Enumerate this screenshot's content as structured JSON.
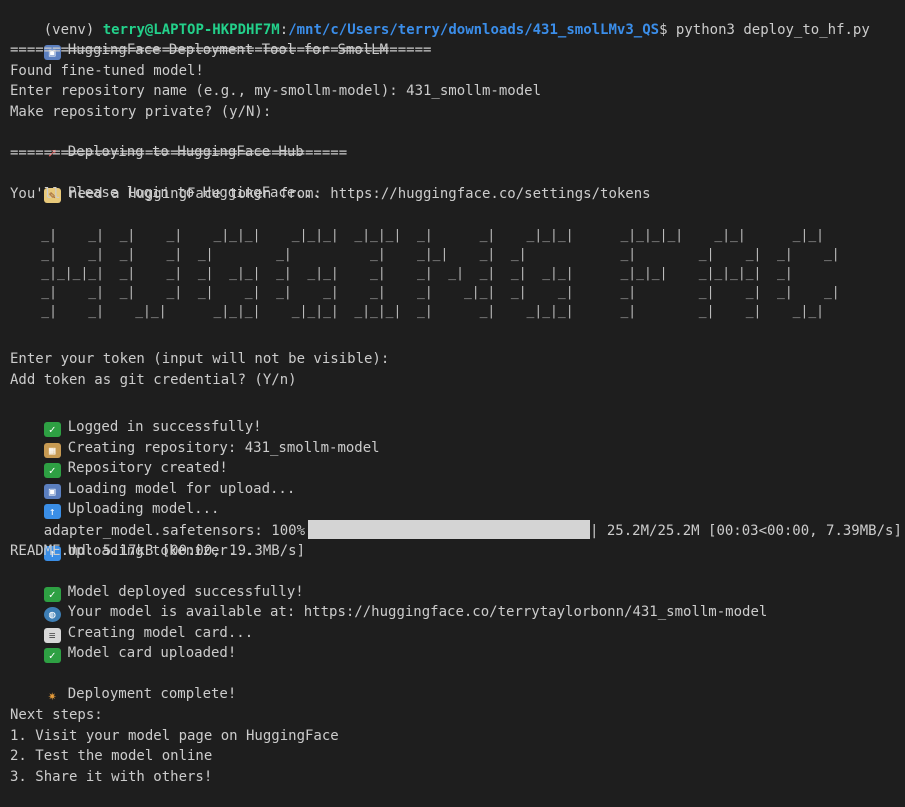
{
  "prompt": {
    "venv": "(venv) ",
    "user_host": "terry@LAPTOP-HKPDHF7M",
    "colon": ":",
    "path": "/mnt/c/Users/terry/downloads/431_smolLMv3_QS",
    "dollar": "$ ",
    "command": "python3 deploy_to_hf.py"
  },
  "tool_title": "HuggingFace Deployment Tool for SmolLM",
  "rule_long": "==================================================",
  "found_model": "Found fine-tuned model!",
  "repo_prompt": "Enter repository name (e.g., my-smollm-model): 431_smollm-model",
  "private_prompt": "Make repository private? (y/N):",
  "deploying": "Deploying to HuggingFace Hub",
  "rule_short": "========================================",
  "login": "Please login to HuggingFace...",
  "token_url": "You'll need a HuggingFace token from: https://huggingface.co/settings/tokens",
  "banner": "    _|    _|  _|    _|    _|_|_|    _|_|_|  _|_|_|  _|      _|    _|_|_|      _|_|_|_|    _|_|      _|_|\n    _|    _|  _|    _|  _|        _|          _|    _|_|    _|  _|            _|        _|    _|  _|    _|\n    _|_|_|_|  _|    _|  _|  _|_|  _|  _|_|    _|    _|  _|  _|  _|  _|_|      _|_|_|    _|_|_|_|  _|\n    _|    _|  _|    _|  _|    _|  _|    _|    _|    _|    _|_|  _|    _|      _|        _|    _|  _|    _|\n    _|    _|    _|_|      _|_|_|    _|_|_|  _|_|_|  _|      _|    _|_|_|      _|        _|    _|    _|_|",
  "token_prompt": "Enter your token (input will not be visible):",
  "git_cred": "Add token as git credential? (Y/n)",
  "logged_in": "Logged in successfully!",
  "creating_repo": "Creating repository: 431_smollm-model",
  "repo_created": "Repository created!",
  "loading_model": "Loading model for upload...",
  "uploading_model": "Uploading model...",
  "progress": {
    "label": "adapter_model.safetensors: 100%",
    "fraction": 1.0,
    "stats": "| 25.2M/25.2M [00:03<00:00, 7.39MB/s]"
  },
  "uploading_tokenizer": "Uploading tokenizer...",
  "readme": "README.md: 5.17kB [00:00, 19.3MB/s]",
  "deployed": "Model deployed successfully!",
  "model_url": "Your model is available at: https://huggingface.co/terrytaylorbonn/431_smollm-model",
  "creating_card": "Creating model card...",
  "card_uploaded": "Model card uploaded!",
  "complete": "Deployment complete!",
  "next_steps_title": "Next steps:",
  "next_steps": [
    "1. Visit your model page on HuggingFace",
    "2. Test the model online",
    "3. Share it with others!"
  ],
  "icons": {
    "robot": "robot-icon",
    "rocket": "rocket-icon",
    "memo": "memo-icon",
    "check": "check-mark-icon",
    "package": "package-icon",
    "upload": "upload-arrow-icon",
    "globe": "globe-icon",
    "page": "page-icon",
    "party": "party-popper-icon"
  },
  "colors": {
    "background": "#1e1e1e",
    "text": "#cccccc",
    "user_host": "#23d18b",
    "path": "#3b8eea",
    "check": "#2ea043"
  }
}
